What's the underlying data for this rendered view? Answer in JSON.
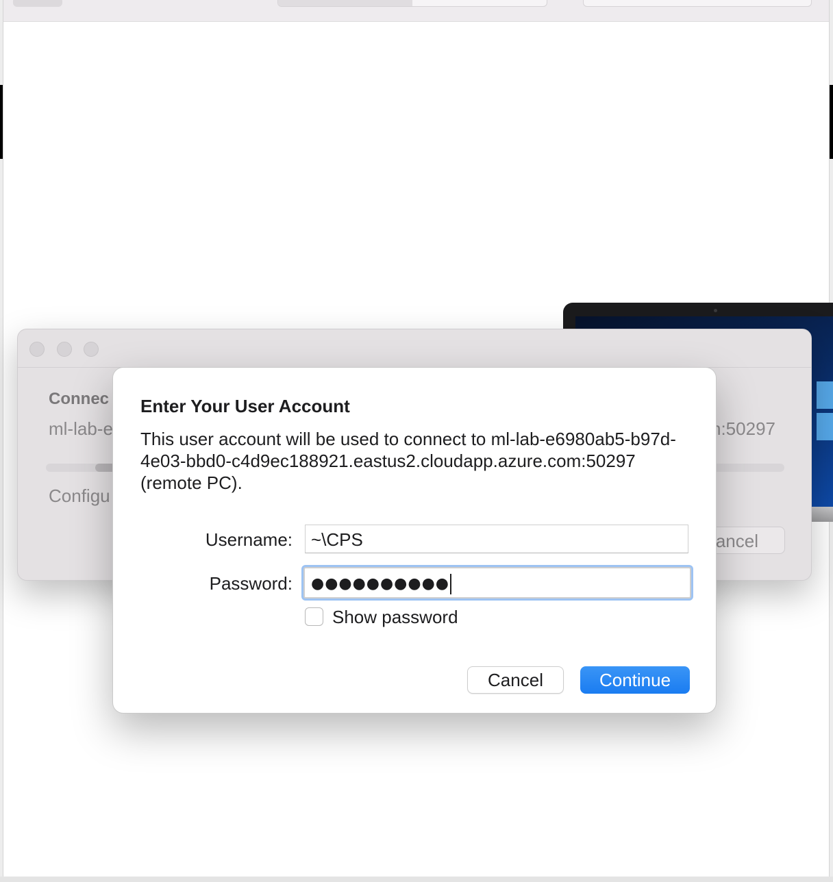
{
  "connection_window": {
    "heading_visible": "Connec",
    "host_visible": "ml-lab-e",
    "port_visible": "n:50297",
    "status_visible": "Configu",
    "cancel_visible": "ancel",
    "progress": 0.1
  },
  "dialog": {
    "title": "Enter Your User Account",
    "message": "This user account will be used to connect to ml-lab-e6980ab5-b97d-4e03-bbd0-c4d9ec188921.eastus2.cloudapp.azure.com:50297 (remote PC).",
    "username_label": "Username:",
    "username_value": "~\\CPS",
    "password_label": "Password:",
    "password_masked": "●●●●●●●●●●",
    "show_password_label": "Show password",
    "show_password_checked": false,
    "cancel_label": "Cancel",
    "continue_label": "Continue"
  },
  "colors": {
    "accent": "#1a7cf1",
    "focus_ring": "#9dc3f3"
  }
}
